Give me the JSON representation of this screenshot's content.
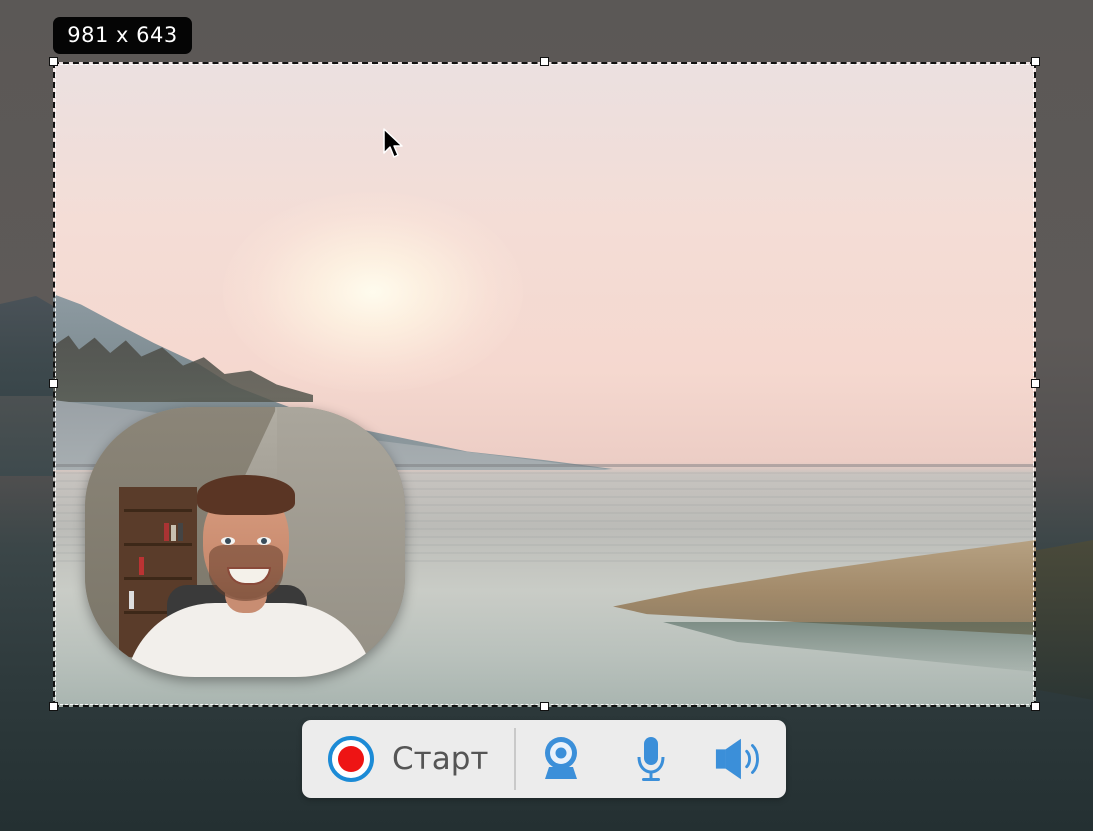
{
  "selection": {
    "size_label": "981 x 643"
  },
  "toolbar": {
    "start_label": "Старт",
    "icons": {
      "record": "record-icon",
      "webcam": "webcam-icon",
      "microphone": "microphone-icon",
      "speaker": "speaker-icon"
    }
  },
  "colors": {
    "accent_blue": "#1c8bd6",
    "record_red": "#ee1414",
    "icon_blue": "#3b8fd9",
    "toolbar_bg": "#ececec",
    "badge_bg": "#050505"
  }
}
